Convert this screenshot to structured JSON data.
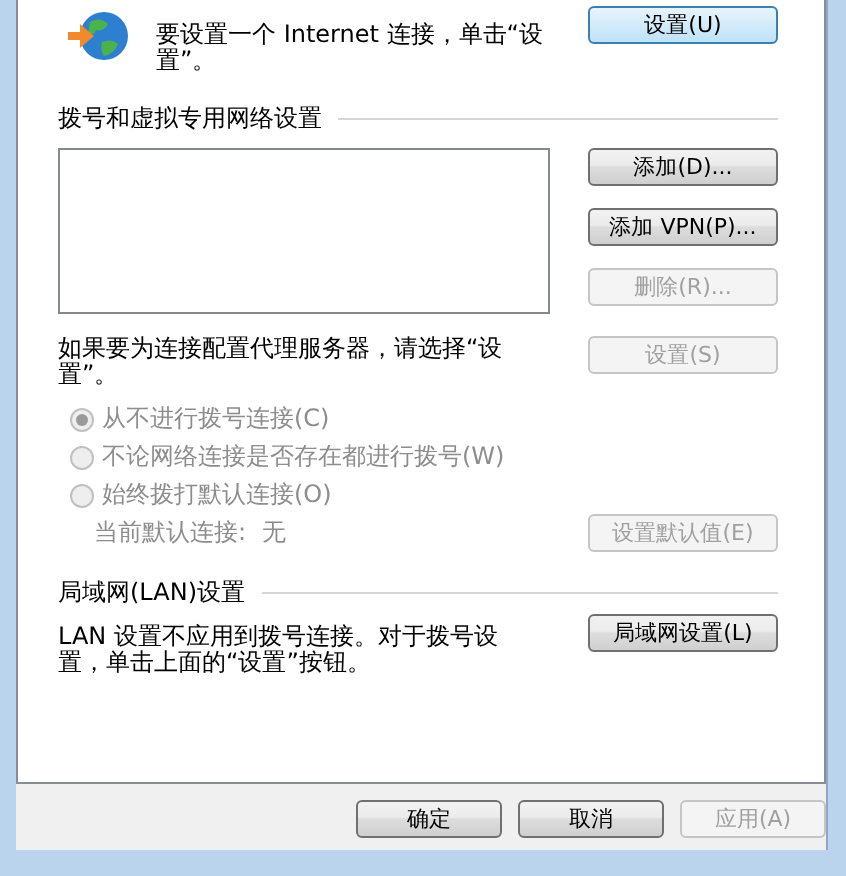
{
  "setup": {
    "text": "要设置一个 Internet 连接，单击“设置”。",
    "button": {
      "label": "设置(U)",
      "disabled": false
    }
  },
  "dialup": {
    "heading": "拨号和虚拟专用网络设置",
    "buttons": [
      {
        "label": "添加(D)...",
        "disabled": false
      },
      {
        "label": "添加 VPN(P)...",
        "disabled": false
      },
      {
        "label": "删除(R)...",
        "disabled": true
      }
    ]
  },
  "proxy": {
    "text": "如果要为连接配置代理服务器，请选择“设置”。",
    "button": {
      "label": "设置(S)",
      "disabled": true
    }
  },
  "dial_options": {
    "disabled": true,
    "options": [
      {
        "label": "从不进行拨号连接(C)",
        "selected": true
      },
      {
        "label": "不论网络连接是否存在都进行拨号(W)",
        "selected": false
      },
      {
        "label": "始终拨打默认连接(O)",
        "selected": false
      }
    ]
  },
  "default_connection": {
    "label": "当前默认连接:",
    "value": "无",
    "disabled": true,
    "button": {
      "label": "设置默认值(E)",
      "disabled": true
    }
  },
  "lan": {
    "heading": "局域网(LAN)设置",
    "text": "LAN 设置不应用到拨号连接。对于拨号设置，单击上面的“设置”按钮。",
    "button": {
      "label": "局域网设置(L)",
      "disabled": false
    }
  },
  "footer_buttons": [
    {
      "label": "确定",
      "disabled": false
    },
    {
      "label": "取消",
      "disabled": false
    },
    {
      "label": "应用(A)",
      "disabled": true
    }
  ]
}
